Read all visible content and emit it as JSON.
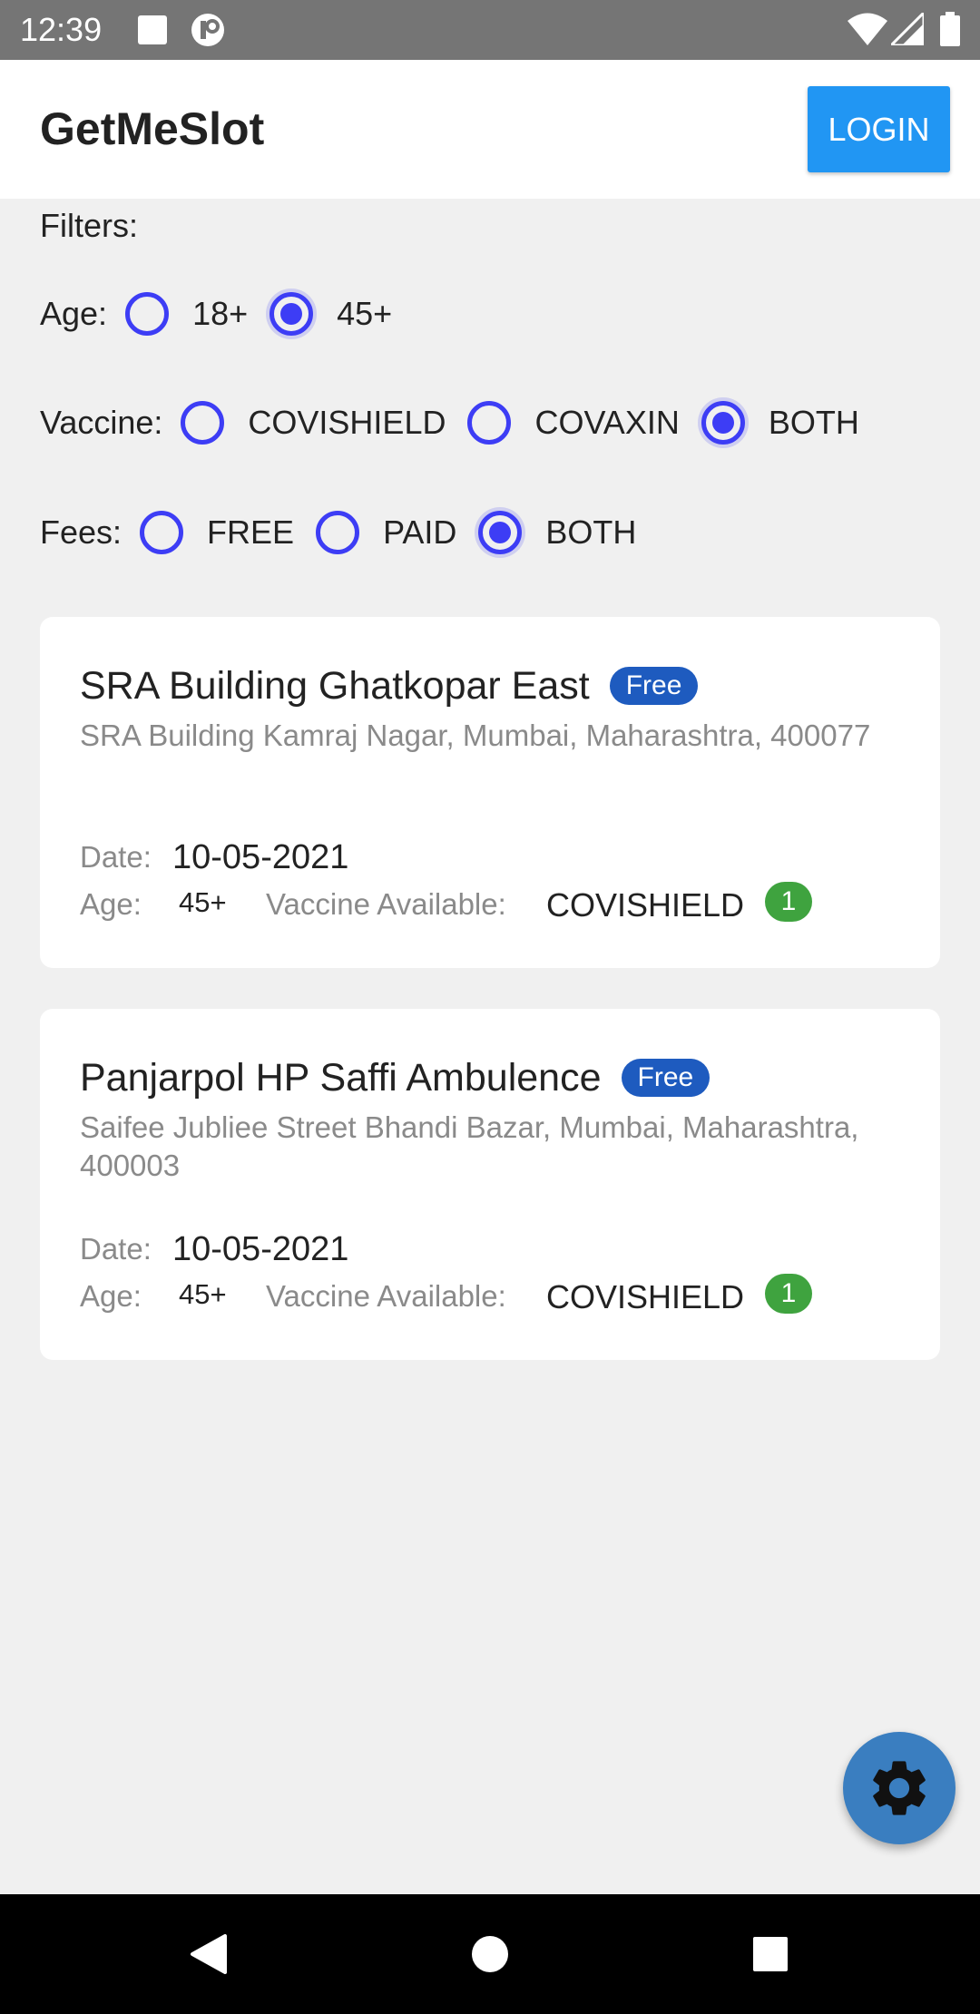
{
  "status_bar": {
    "time": "12:39",
    "icons": [
      "square-notification-icon",
      "app-notification-icon",
      "wifi-icon",
      "signal-icon",
      "battery-icon"
    ]
  },
  "app_bar": {
    "title": "GetMeSlot",
    "login_label": "LOGIN"
  },
  "filters": {
    "label": "Filters:",
    "age": {
      "label": "Age:",
      "options": [
        {
          "label": "18+",
          "checked": false
        },
        {
          "label": "45+",
          "checked": true
        }
      ]
    },
    "vaccine": {
      "label": "Vaccine:",
      "options": [
        {
          "label": "COVISHIELD",
          "checked": false
        },
        {
          "label": "COVAXIN",
          "checked": false
        },
        {
          "label": "BOTH",
          "checked": true
        }
      ]
    },
    "fees": {
      "label": "Fees:",
      "options": [
        {
          "label": "FREE",
          "checked": false
        },
        {
          "label": "PAID",
          "checked": false
        },
        {
          "label": "BOTH",
          "checked": true
        }
      ]
    }
  },
  "centers": [
    {
      "name": "SRA Building Ghatkopar East",
      "fee_badge": "Free",
      "address": "SRA Building Kamraj Nagar, Mumbai, Maharashtra, 400077",
      "date_label": "Date:",
      "date": "10-05-2021",
      "age_label": "Age:",
      "age": "45+",
      "vaccine_label": "Vaccine Available:",
      "vaccine": "COVISHIELD",
      "available_count": "1"
    },
    {
      "name": "Panjarpol HP Saffi Ambulence",
      "fee_badge": "Free",
      "address": "Saifee Jubliee Street Bhandi Bazar, Mumbai, Maharashtra, 400003",
      "date_label": "Date:",
      "date": "10-05-2021",
      "age_label": "Age:",
      "age": "45+",
      "vaccine_label": "Vaccine Available:",
      "vaccine": "COVISHIELD",
      "available_count": "1"
    }
  ],
  "fab": {
    "icon": "gear-icon"
  },
  "nav_bar": {
    "icons": [
      "back-icon",
      "home-icon",
      "recents-icon"
    ]
  },
  "colors": {
    "status_bar": "#757575",
    "login_button": "#2196f3",
    "radio": "#3d3df5",
    "fee_badge": "#1e5bbf",
    "count_badge": "#3fa33f",
    "fab": "#3a7ec0",
    "background": "#f0f0f0"
  }
}
